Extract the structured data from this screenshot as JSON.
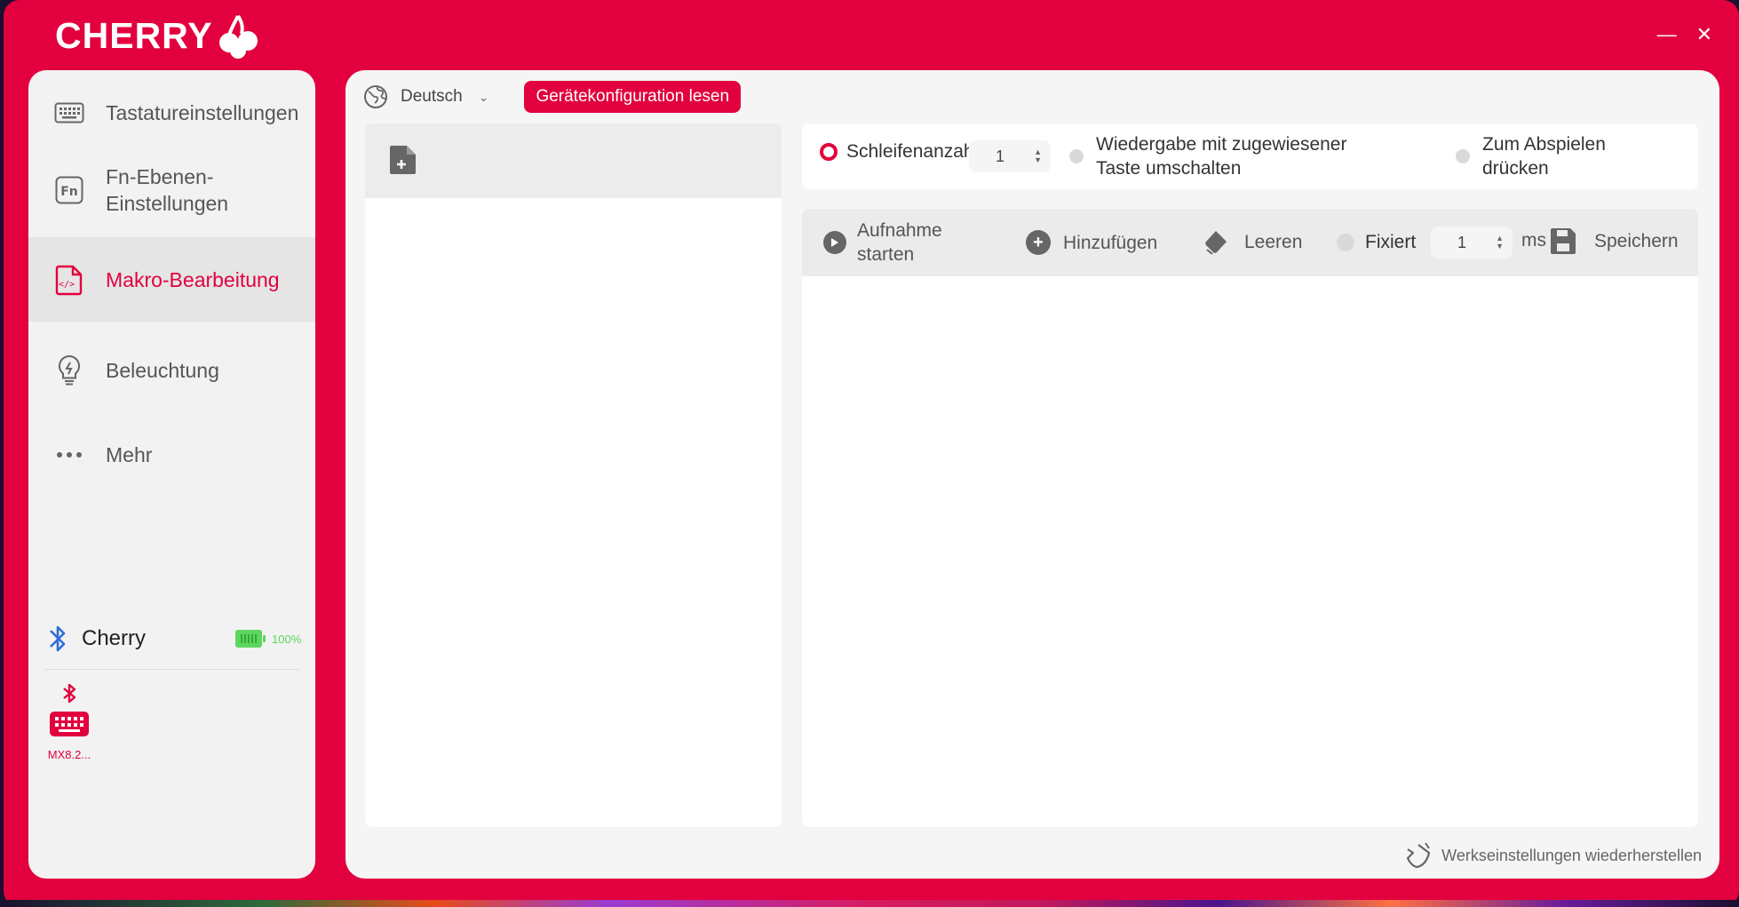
{
  "app": {
    "brand": "CHERRY"
  },
  "window_controls": {
    "minimize": "—",
    "close": "✕"
  },
  "sidebar": {
    "items": [
      {
        "label": "Tastatureinstellungen",
        "icon": "keyboard-icon"
      },
      {
        "label": "Fn-Ebenen-Einstellungen",
        "icon": "fn-icon"
      },
      {
        "label": "Makro-Bearbeitung",
        "icon": "macro-file-icon",
        "active": true
      },
      {
        "label": "Beleuchtung",
        "icon": "bulb-icon"
      },
      {
        "label": "Mehr",
        "icon": "more-dots-icon"
      }
    ],
    "device": {
      "name": "Cherry",
      "battery": "100%",
      "connection": "bluetooth-icon"
    },
    "device_card": {
      "label": "MX8.2..."
    }
  },
  "main": {
    "language": "Deutsch",
    "read_config_button": "Gerätekonfiguration lesen",
    "options": {
      "loop_count_label": "Schleifenanzahl",
      "loop_count_value": "1",
      "toggle_playback_label": "Wiedergabe mit zugewiesener Taste umschalten",
      "press_to_play_label": "Zum Abspielen drücken"
    },
    "recorder": {
      "start_recording": "Aufnahme starten",
      "add": "Hinzufügen",
      "clear": "Leeren",
      "fixed_label": "Fixiert",
      "fixed_value": "1",
      "unit": "ms",
      "save": "Speichern"
    },
    "factory_reset": "Werkseinstellungen wiederherstellen"
  },
  "colors": {
    "brand": "#e2003e",
    "battery": "#5cd65c",
    "bluetooth": "#2f6fd6"
  }
}
